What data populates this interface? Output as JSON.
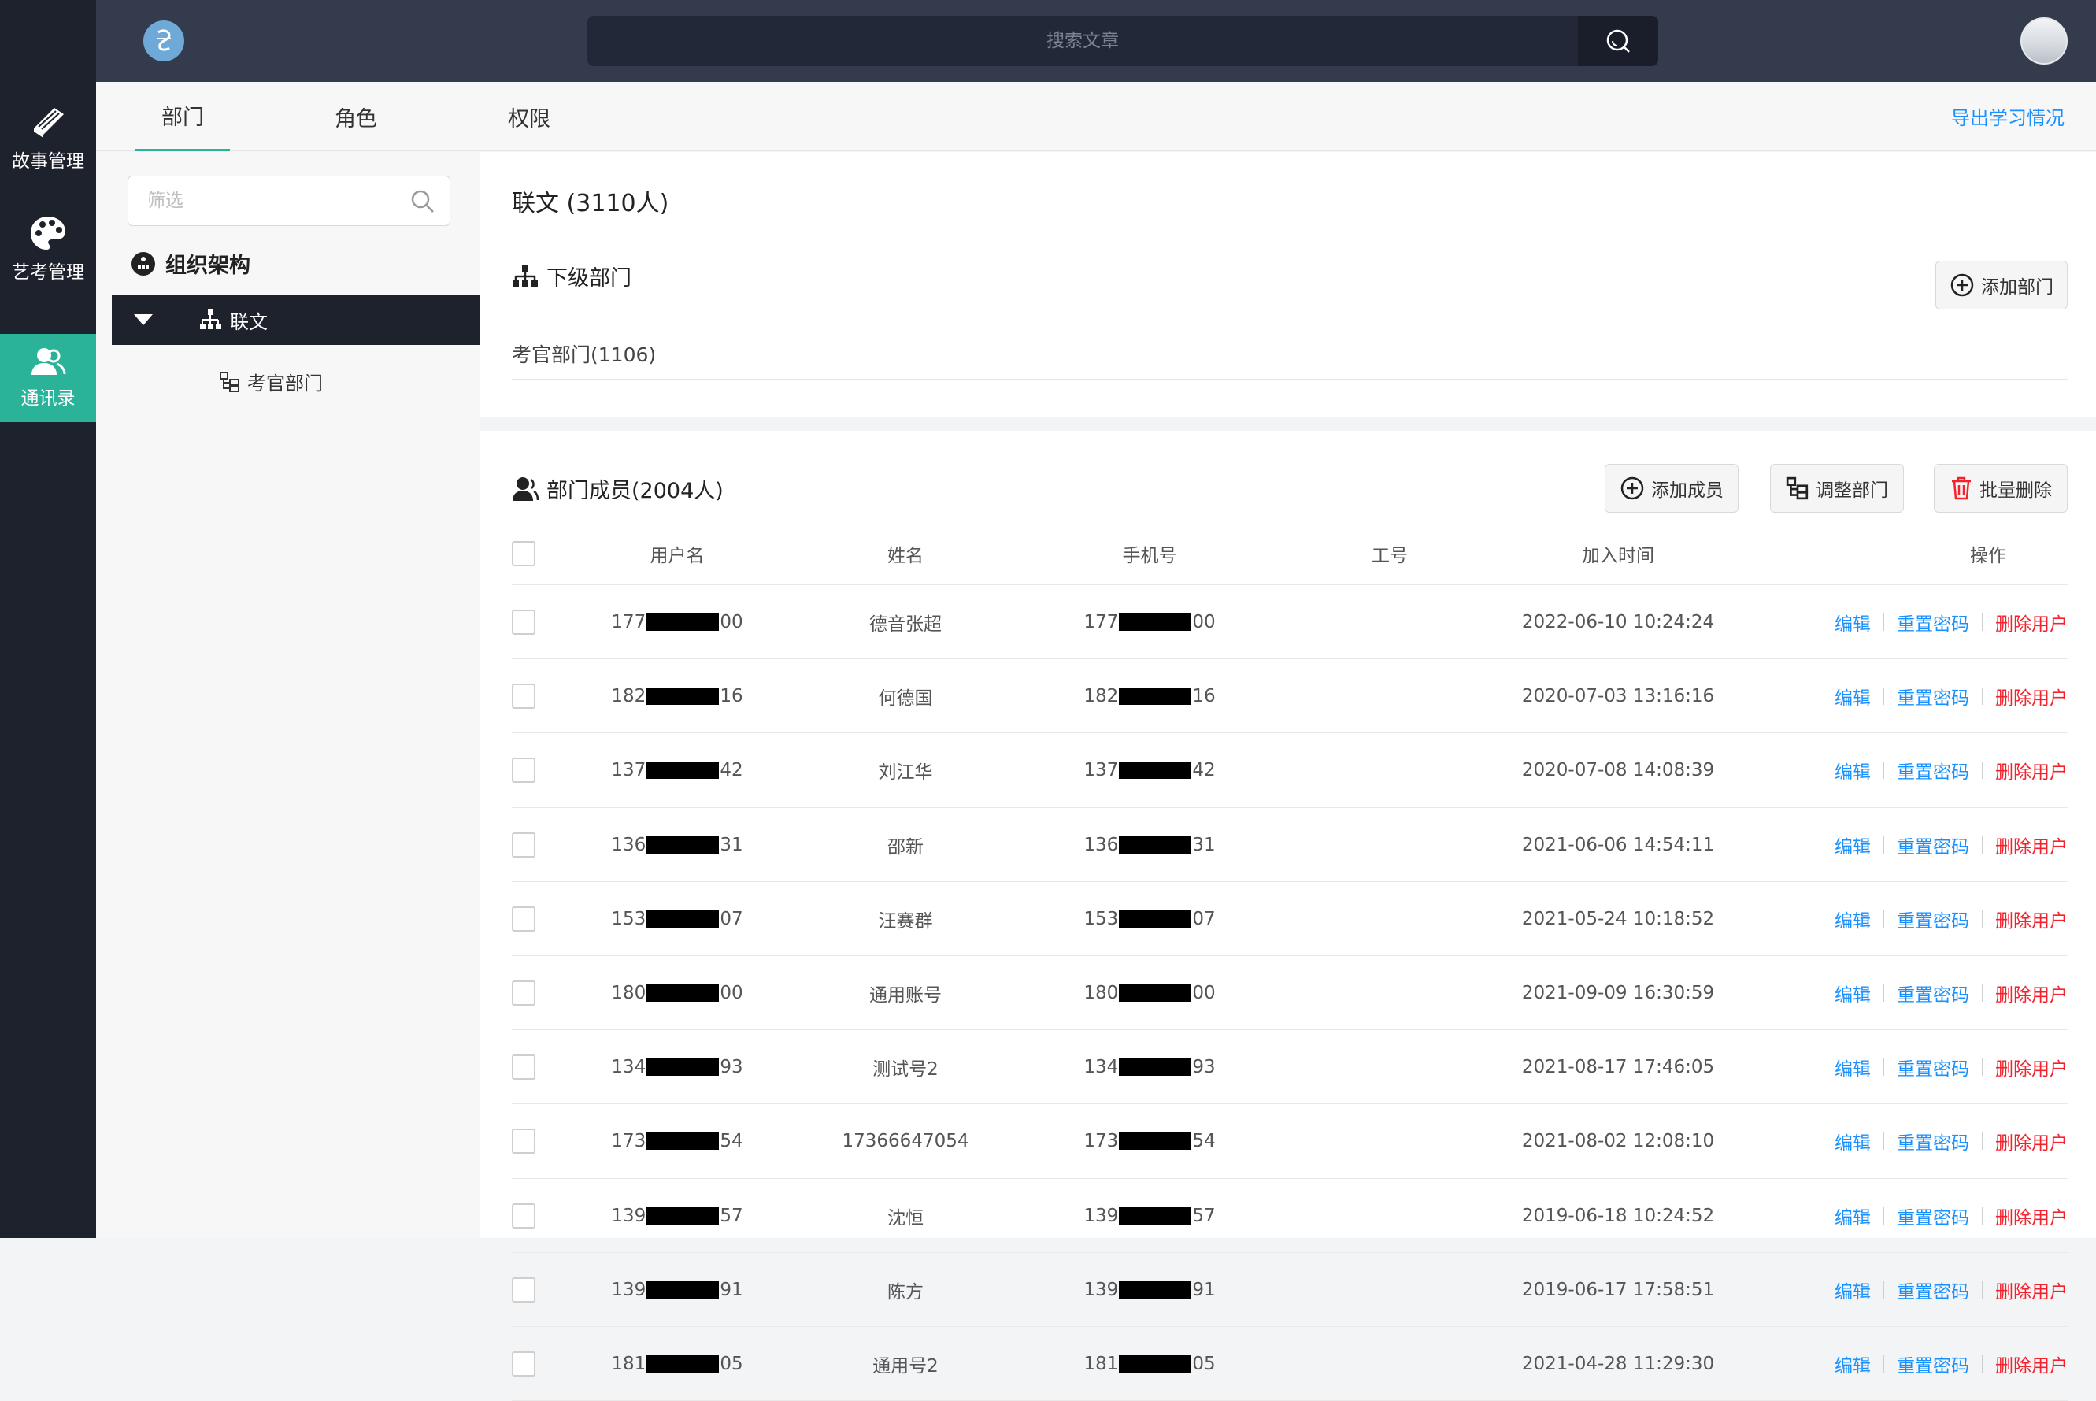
{
  "rail": {
    "items": [
      {
        "label": "故事管理",
        "icon": "book-icon"
      },
      {
        "label": "艺考管理",
        "icon": "palette-icon"
      },
      {
        "label": "通讯录",
        "icon": "contacts-icon",
        "active": true
      }
    ],
    "active_color": "#2bb39a"
  },
  "header": {
    "search_placeholder": "搜索文章",
    "search_icon": "search-icon"
  },
  "tabs": {
    "items": [
      "部门",
      "角色",
      "权限"
    ],
    "active": "部门",
    "export_label": "导出学习情况"
  },
  "tree": {
    "filter_placeholder": "筛选",
    "root_label": "组织架构",
    "selected_label": "联文",
    "child_label": "考官部门"
  },
  "department": {
    "title": "联文 (3110人)",
    "sub_heading": "下级部门",
    "add_dept_label": "添加部门",
    "sub_depts": [
      "考官部门(1106)"
    ]
  },
  "members": {
    "heading": "部门成员(2004人)",
    "add_member_label": "添加成员",
    "adjust_dept_label": "调整部门",
    "batch_delete_label": "批量删除",
    "columns": [
      "用户名",
      "姓名",
      "手机号",
      "工号",
      "加入时间",
      "操作"
    ],
    "actions": {
      "edit": "编辑",
      "reset": "重置密码",
      "delete": "删除用户"
    },
    "rows": [
      {
        "user_pre": "177",
        "user_suf": "00",
        "name": "德音张超",
        "phone_pre": "177",
        "phone_suf": "00",
        "emp_no": "",
        "joined": "2022-06-10 10:24:24"
      },
      {
        "user_pre": "182",
        "user_suf": "16",
        "name": "何德国",
        "phone_pre": "182",
        "phone_suf": "16",
        "emp_no": "",
        "joined": "2020-07-03 13:16:16"
      },
      {
        "user_pre": "137",
        "user_suf": "42",
        "name": "刘江华",
        "phone_pre": "137",
        "phone_suf": "42",
        "emp_no": "",
        "joined": "2020-07-08 14:08:39"
      },
      {
        "user_pre": "136",
        "user_suf": "31",
        "name": "邵新",
        "phone_pre": "136",
        "phone_suf": "31",
        "emp_no": "",
        "joined": "2021-06-06 14:54:11"
      },
      {
        "user_pre": "153",
        "user_suf": "07",
        "name": "汪赛群",
        "phone_pre": "153",
        "phone_suf": "07",
        "emp_no": "",
        "joined": "2021-05-24 10:18:52"
      },
      {
        "user_pre": "180",
        "user_suf": "00",
        "name": "通用账号",
        "phone_pre": "180",
        "phone_suf": "00",
        "emp_no": "",
        "joined": "2021-09-09 16:30:59"
      },
      {
        "user_pre": "134",
        "user_suf": "93",
        "name": "测试号2",
        "phone_pre": "134",
        "phone_suf": "93",
        "emp_no": "",
        "joined": "2021-08-17 17:46:05"
      },
      {
        "user_pre": "173",
        "user_suf": "54",
        "name": "17366647054",
        "phone_pre": "173",
        "phone_suf": "54",
        "emp_no": "",
        "joined": "2021-08-02 12:08:10"
      },
      {
        "user_pre": "139",
        "user_suf": "57",
        "name": "沈恒",
        "phone_pre": "139",
        "phone_suf": "57",
        "emp_no": "",
        "joined": "2019-06-18 10:24:52"
      },
      {
        "user_pre": "139",
        "user_suf": "91",
        "name": "陈方",
        "phone_pre": "139",
        "phone_suf": "91",
        "emp_no": "",
        "joined": "2019-06-17 17:58:51"
      },
      {
        "user_pre": "181",
        "user_suf": "05",
        "name": "通用号2",
        "phone_pre": "181",
        "phone_suf": "05",
        "emp_no": "",
        "joined": "2021-04-28 11:29:30"
      }
    ]
  },
  "colors": {
    "rail_bg": "#1e222d",
    "header_bg": "#333b4d",
    "accent": "#2bb39a",
    "link_blue": "#1890ff",
    "danger_red": "#f5222d"
  }
}
